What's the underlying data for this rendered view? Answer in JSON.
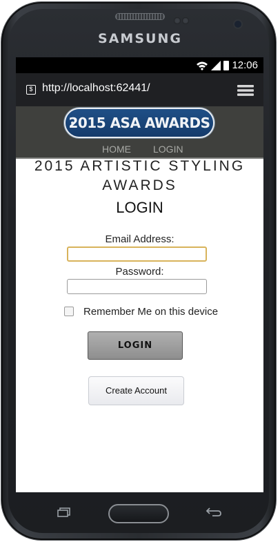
{
  "device": {
    "brand": "SAMSUNG"
  },
  "status_bar": {
    "time": "12:06"
  },
  "browser": {
    "url": "http://localhost:62441/"
  },
  "site": {
    "banner": "2015 ASA AWARDS",
    "nav": {
      "home": "HOME",
      "login": "LOGIN"
    }
  },
  "page": {
    "title_line1": "2015 ARTISTIC STYLING",
    "title_line2": "AWARDS",
    "heading": "LOGIN",
    "email_label": "Email Address:",
    "password_label": "Password:",
    "remember_label": "Remember Me on this device",
    "login_button": "LOGIN",
    "create_account_button": "Create Account"
  },
  "colors": {
    "header_bg": "#3f403d",
    "banner_blue": "#1f4f86",
    "focus_border": "#d8b35a"
  }
}
